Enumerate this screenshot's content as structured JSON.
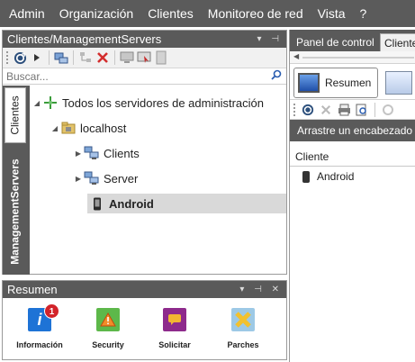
{
  "menubar": {
    "items": [
      "Admin",
      "Organización",
      "Clientes",
      "Monitoreo de red",
      "Vista",
      "?"
    ]
  },
  "left_panel": {
    "title": "Clientes/ManagementServers",
    "title_controls": "▾ ⊣",
    "search_placeholder": "Buscar...",
    "vertical_tabs": [
      "Clientes",
      "ManagementServers"
    ],
    "tree": [
      {
        "label": "Todos los servidores de administración",
        "expanded": true,
        "selected": false
      },
      {
        "label": "localhost",
        "expanded": true,
        "selected": false
      },
      {
        "label": "Clients",
        "expanded": false,
        "selected": false
      },
      {
        "label": "Server",
        "expanded": false,
        "selected": false
      },
      {
        "label": "Android",
        "expanded": false,
        "selected": true
      }
    ]
  },
  "resumen_panel": {
    "title": "Resumen",
    "title_controls": "▾ ⊣ ✕",
    "tiles": [
      {
        "label": "Información",
        "badge": "1",
        "color": "#1e73d6"
      },
      {
        "label": "Security",
        "color": "#5db84a"
      },
      {
        "label": "Solicitar",
        "color": "#8e2a8c"
      },
      {
        "label": "Parches",
        "color": "#9dc9e6"
      }
    ]
  },
  "right_panel": {
    "tabs": [
      "Panel de control",
      "Cliente"
    ],
    "big_tab_label": "Resumen",
    "drag_hint": "Arrastre un encabezado",
    "column_header": "Cliente",
    "rows": [
      "Android"
    ]
  }
}
